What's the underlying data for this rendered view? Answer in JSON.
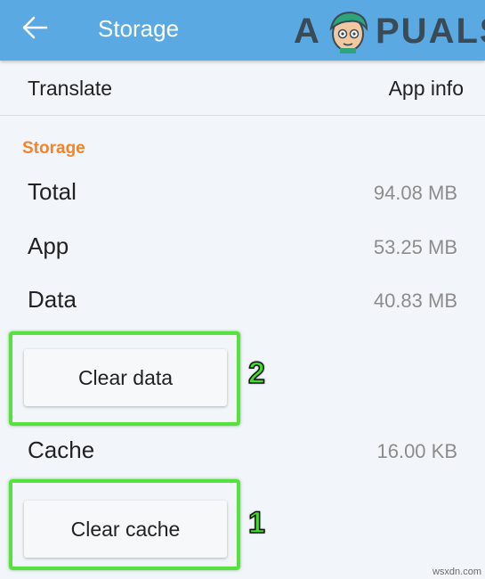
{
  "appbar": {
    "title": "Storage",
    "back_icon": "arrow-left-icon"
  },
  "watermark": {
    "brand_a": "A",
    "brand_rest": "PUALS"
  },
  "subheader": {
    "app_name": "Translate",
    "page_name": "App info"
  },
  "storage": {
    "section_label": "Storage",
    "rows": [
      {
        "label": "Total",
        "value": "94.08 MB"
      },
      {
        "label": "App",
        "value": "53.25 MB"
      },
      {
        "label": "Data",
        "value": "40.83 MB"
      }
    ],
    "clear_data_label": "Clear data",
    "cache": {
      "label": "Cache",
      "value": "16.00 KB"
    },
    "clear_cache_label": "Clear cache"
  },
  "annotations": {
    "clear_data_number": "2",
    "clear_cache_number": "1"
  },
  "footer": {
    "source": "wsxdn.com"
  },
  "colors": {
    "appbar": "#5aa9e2",
    "section_label": "#f0852b",
    "highlight": "#56e23c",
    "background": "#f2f6fa"
  }
}
